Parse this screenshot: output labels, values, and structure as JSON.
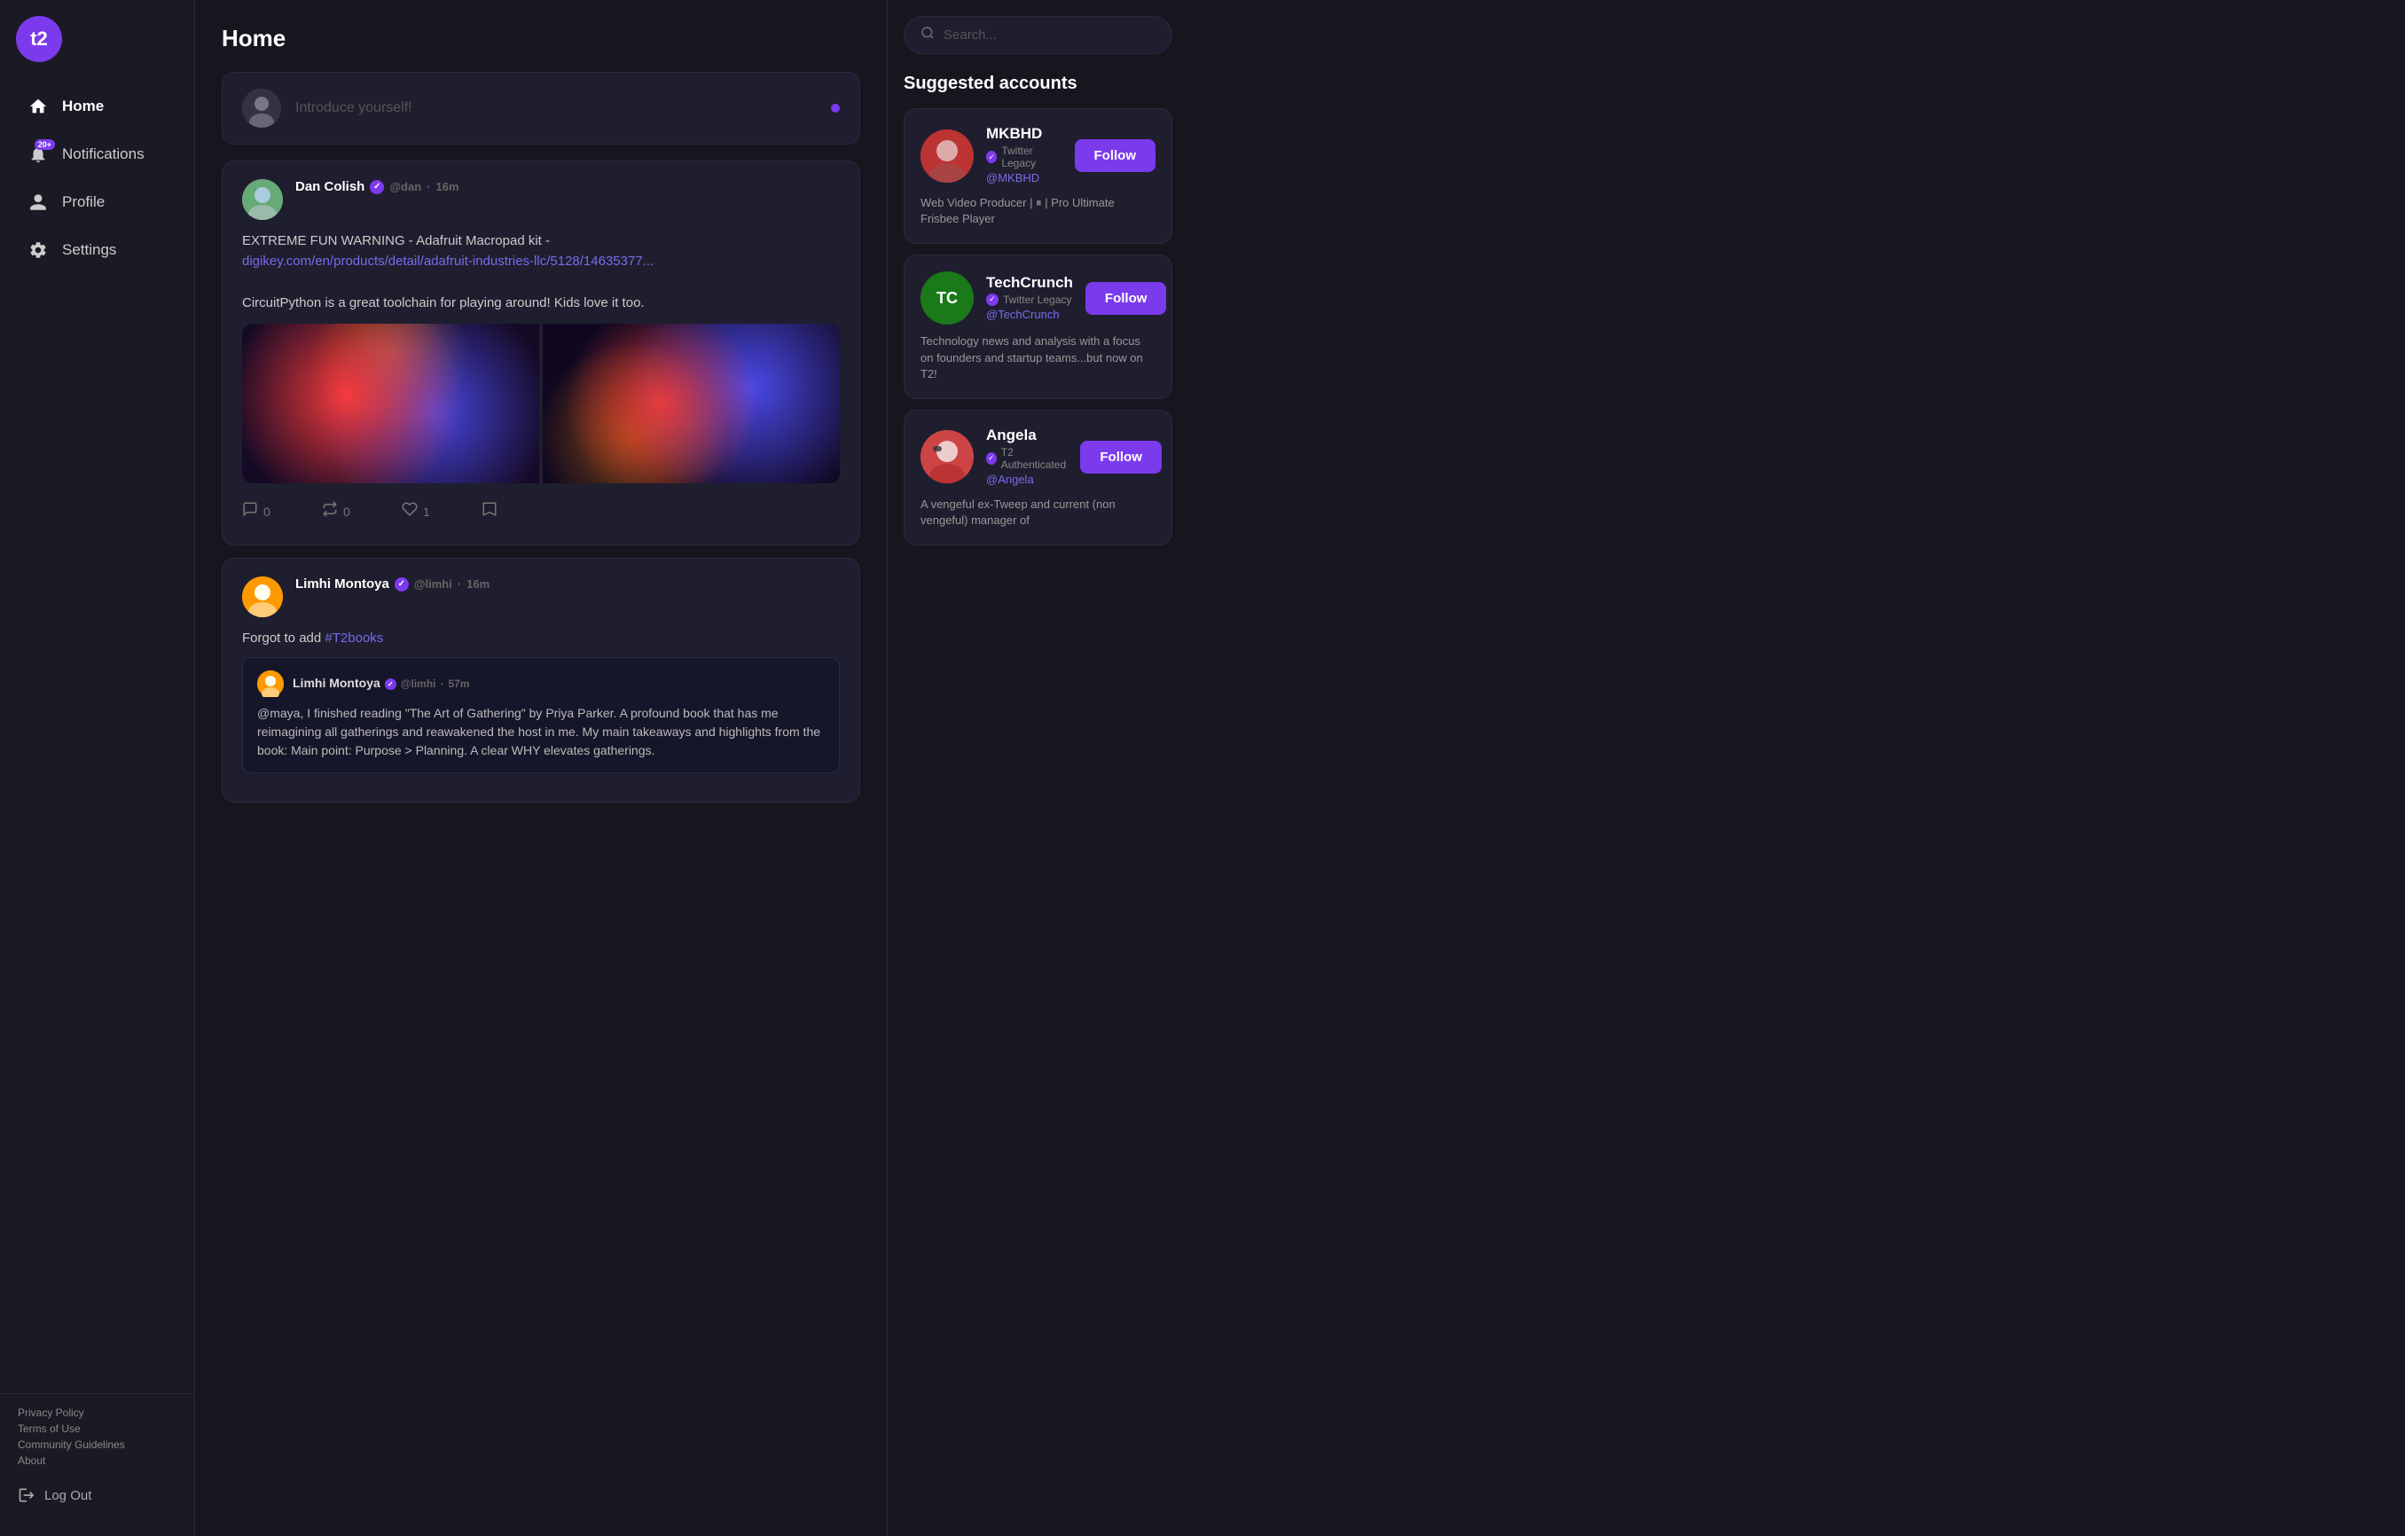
{
  "app": {
    "logo": "t2",
    "title": "Home"
  },
  "sidebar": {
    "nav": [
      {
        "id": "home",
        "label": "Home",
        "icon": "home",
        "active": true,
        "badge": null
      },
      {
        "id": "notifications",
        "label": "Notifications",
        "icon": "bell",
        "active": false,
        "badge": "20+"
      },
      {
        "id": "profile",
        "label": "Profile",
        "icon": "user",
        "active": false,
        "badge": null
      },
      {
        "id": "settings",
        "label": "Settings",
        "icon": "gear",
        "active": false,
        "badge": null
      }
    ],
    "footer_links": [
      {
        "id": "privacy",
        "label": "Privacy Policy"
      },
      {
        "id": "terms",
        "label": "Terms of Use"
      },
      {
        "id": "community",
        "label": "Community Guidelines"
      },
      {
        "id": "about",
        "label": "About"
      }
    ],
    "logout": "Log Out"
  },
  "compose": {
    "placeholder": "Introduce yourself!"
  },
  "posts": [
    {
      "id": "post1",
      "author": "Dan Colish",
      "handle": "@dan",
      "time": "16m",
      "verified": true,
      "body_text": "EXTREME FUN WARNING - Adafruit Macropad kit -",
      "link_text": "digikey.com/en/products/detail/adafruit-industries-llc/5128/14635377...",
      "body_extra": "CircuitPython is a great toolchain for playing around! Kids love it too.",
      "has_images": true,
      "actions": [
        {
          "id": "comment",
          "icon": "💬",
          "count": "0"
        },
        {
          "id": "repost",
          "icon": "🔄",
          "count": "0"
        },
        {
          "id": "like",
          "icon": "♡",
          "count": "1"
        },
        {
          "id": "bookmark",
          "icon": "🚩",
          "count": ""
        }
      ]
    },
    {
      "id": "post2",
      "author": "Limhi Montoya",
      "handle": "@limhi",
      "time": "16m",
      "verified": true,
      "body_text": "Forgot to add ",
      "hashtag": "#T2books",
      "quoted": {
        "author": "Limhi Montoya",
        "handle": "@limhi",
        "time": "57m",
        "verified": true,
        "body": "@maya, I finished reading \"The Art of Gathering\" by Priya Parker. A profound book that has me reimagining all gatherings and reawakened the host in me.\n\nMy main takeaways and highlights from the book:\n\nMain point: Purpose > Planning. A clear WHY elevates gatherings."
      }
    }
  ],
  "search": {
    "placeholder": "Search..."
  },
  "suggested": {
    "title": "Suggested accounts",
    "accounts": [
      {
        "id": "mkbhd",
        "name": "MKBHD",
        "badge_label": "Twitter Legacy",
        "handle": "@MKBHD",
        "desc": "Web Video Producer | ⏸ | Pro Ultimate Frisbee Player",
        "follow_label": "Follow",
        "avatar_type": "mkbhd"
      },
      {
        "id": "techcrunch",
        "name": "TechCrunch",
        "badge_label": "Twitter Legacy",
        "handle": "@TechCrunch",
        "desc": "Technology news and analysis with a focus on founders and startup teams...but now on T2!",
        "follow_label": "Follow",
        "avatar_type": "tc",
        "avatar_text": "TC"
      },
      {
        "id": "angela",
        "name": "Angela",
        "badge_label": "T2 Authenticated",
        "handle": "@Angela",
        "desc": "A vengeful ex-Tweep and current (non vengeful) manager of",
        "follow_label": "Follow",
        "avatar_type": "angela"
      }
    ]
  }
}
